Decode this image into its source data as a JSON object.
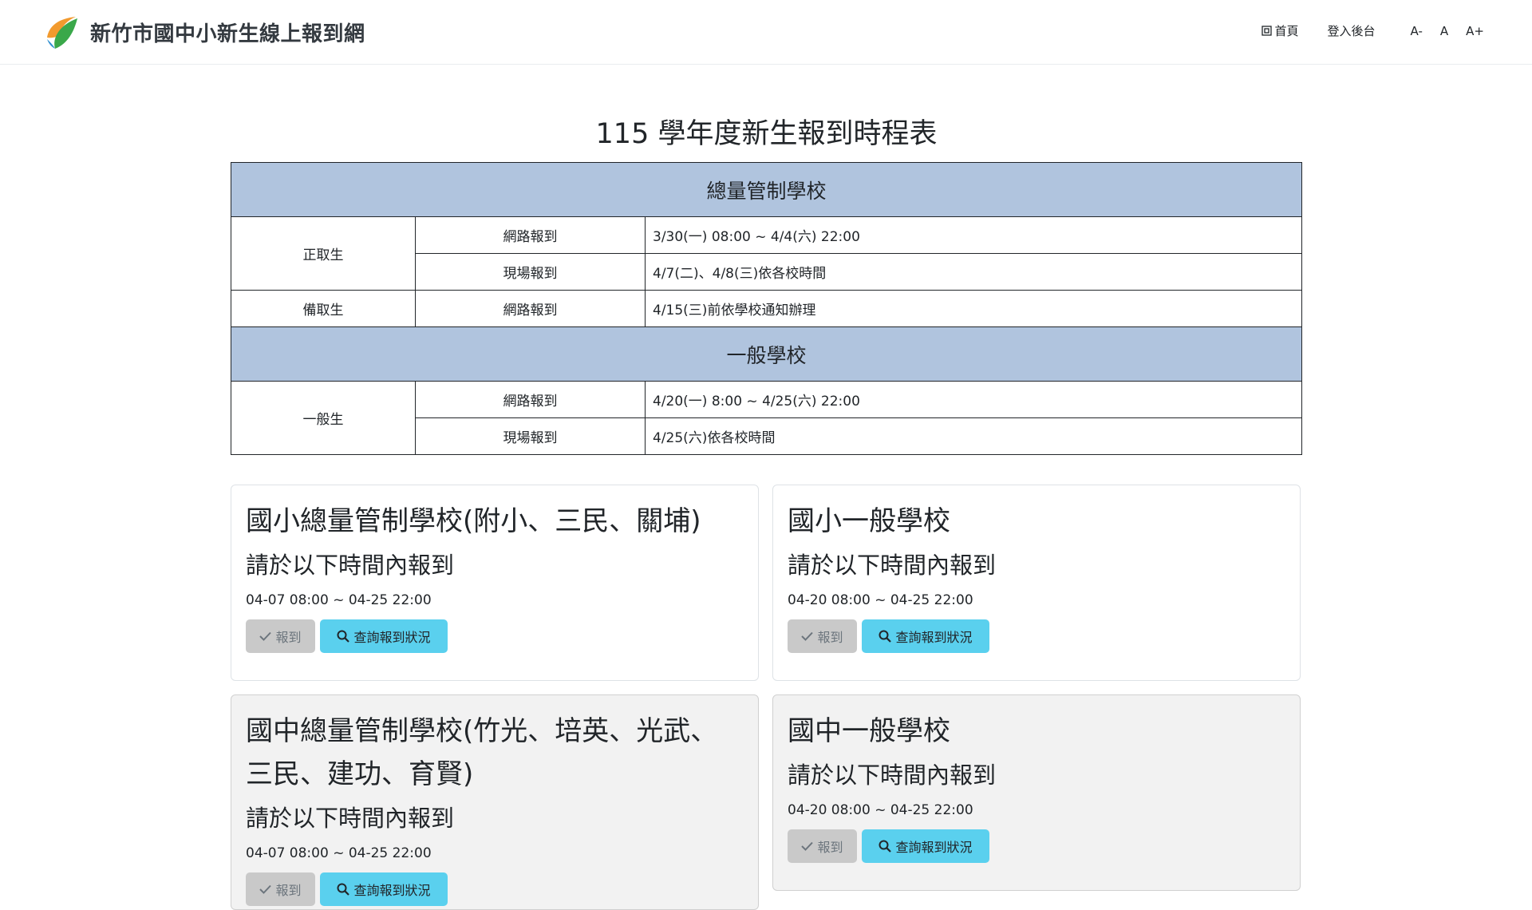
{
  "header": {
    "site_title": "新竹市國中小新生線上報到網",
    "nav": {
      "home": "首頁",
      "admin": "登入後台",
      "font_smaller": "A-",
      "font_normal": "A",
      "font_larger": "A+"
    },
    "logo_colors": [
      "#f29a2e",
      "#3aa84a",
      "#2f8fd0"
    ]
  },
  "page_title": "115 學年度新生報到時程表",
  "schedule": {
    "section1": {
      "title": "總量管制學校",
      "rows": [
        {
          "group": "正取生",
          "method": "網路報到",
          "time": "3/30(一) 08:00 ~ 4/4(六) 22:00"
        },
        {
          "group": "",
          "method": "現場報到",
          "time": "4/7(二)、4/8(三)依各校時間"
        },
        {
          "group": "備取生",
          "method": "網路報到",
          "time": "4/15(三)前依學校通知辦理"
        }
      ]
    },
    "section2": {
      "title": "一般學校",
      "rows": [
        {
          "group": "一般生",
          "method": "網路報到",
          "time": "4/20(一) 8:00 ~ 4/25(六) 22:00"
        },
        {
          "group": "",
          "method": "現場報到",
          "time": "4/25(六)依各校時間"
        }
      ]
    },
    "header_color": "#b0c4de"
  },
  "cards": [
    {
      "title": "國小總量管制學校(附小、三民、關埔)",
      "subtitle": "請於以下時間內報到",
      "time": "04-07 08:00 ~ 04-25 22:00",
      "report_label": "報到",
      "query_label": "查詢報到狀況"
    },
    {
      "title": "國小一般學校",
      "subtitle": "請於以下時間內報到",
      "time": "04-20 08:00 ~ 04-25 22:00",
      "report_label": "報到",
      "query_label": "查詢報到狀況"
    },
    {
      "title": "國中總量管制學校(竹光、培英、光武、三民、建功、育賢)",
      "subtitle": "請於以下時間內報到",
      "time": "04-07 08:00 ~ 04-25 22:00",
      "report_label": "報到",
      "query_label": "查詢報到狀況"
    },
    {
      "title": "國中一般學校",
      "subtitle": "請於以下時間內報到",
      "time": "04-20 08:00 ~ 04-25 22:00",
      "report_label": "報到",
      "query_label": "查詢報到狀況"
    }
  ],
  "colors": {
    "query_button": "#5ad0ee",
    "report_button_disabled": "#c9c9c9"
  }
}
